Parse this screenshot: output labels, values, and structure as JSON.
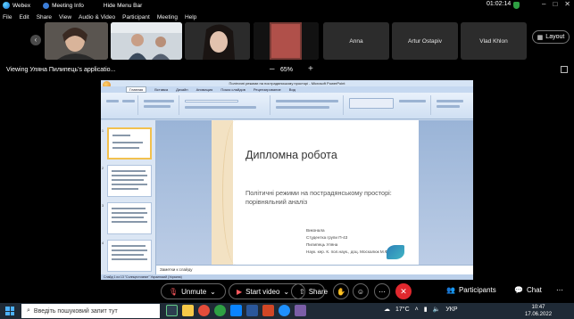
{
  "titlebar": {
    "app": "Webex",
    "meeting_info": "Meeting Info",
    "hide_menu": "Hide Menu Bar",
    "time": "01:02:14"
  },
  "menu": [
    "File",
    "Edit",
    "Share",
    "View",
    "Audio & Video",
    "Participant",
    "Meeting",
    "Help"
  ],
  "participants": {
    "names": [
      "Anna",
      "Artur Ostapiv",
      "Vlad Khlon"
    ],
    "layout_label": "Layout"
  },
  "share": {
    "viewing": "Viewing Уляна Пилипець's applicatio...",
    "zoom": "65%"
  },
  "ppt": {
    "window_title": "Політичні режими на пострадянському просторі - Microsoft PowerPoint",
    "tabs": [
      "Главная",
      "Вставка",
      "Дизайн",
      "Анимация",
      "Показ слайдов",
      "Рецензирование",
      "Вид"
    ],
    "slide_title": "Дипломна робота",
    "slide_subtitle": "Політичні режими на пострадянському просторі: порівняльний аналіз",
    "info": [
      "Виконала",
      "Студентка групи П-43",
      "Пилипець Уляна",
      "Наук. кер. К. пол.наук., доц. Москалюк М.Ф."
    ],
    "notes": "Заметки к слайду",
    "status": "Слайд 1 из 13   \"Солнцестояние\"   Украинский (Украина)"
  },
  "controls": {
    "unmute": "Unmute",
    "start_video": "Start video",
    "share": "Share",
    "participants": "Participants",
    "chat": "Chat"
  },
  "taskbar": {
    "search": "Введіть пошуковий запит тут",
    "weather": "17°C",
    "lang": "УКР",
    "time": "10:47",
    "date": "17.06.2022"
  }
}
